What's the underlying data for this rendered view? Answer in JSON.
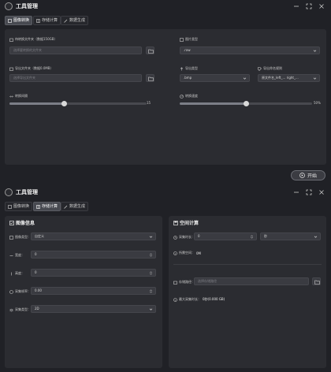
{
  "app": {
    "title": "工具管理"
  },
  "tabs": [
    {
      "label": "图像转换"
    },
    {
      "label": "存储计算"
    },
    {
      "label": "数据生成"
    }
  ],
  "convert": {
    "source_folder_label": "待转换文件夹（数据150GB）",
    "source_folder_placeholder": "选择要转换的文件夹",
    "output_folder_label": "导出文件夹（数据0.0MB）",
    "output_folder_placeholder": "选择导出文件夹",
    "image_type_label": "图片类型",
    "image_type_value": ".raw",
    "export_type_label": "导出类型",
    "export_type_value": ".bmp",
    "naming_rule_label": "导出命名规则",
    "naming_rule_value": "原文件名_left_... right_...",
    "interval_label": "转换间隔",
    "interval_value": "15",
    "interval_level": 0.4,
    "speed_label": "转换速度",
    "speed_value": "50%",
    "speed_level": 0.5,
    "start_label": "开始"
  },
  "calc": {
    "image_info_title": "图像信息",
    "image_type_label": "图像类型：",
    "image_type_value": "自定义",
    "width_label": "宽度：",
    "width_value": "0",
    "height_label": "高度：",
    "height_value": "0",
    "framerate_label": "采集帧率：",
    "framerate_value": "0.00",
    "bitdepth_label": "采集类型：",
    "bitdepth_value": "2D",
    "space_title": "空间计算",
    "duration_label": "采集时长：",
    "duration_value": "0",
    "duration_unit": "秒",
    "required_label": "所需空间：",
    "required_value": "0M",
    "path_label": "存储路径：",
    "path_placeholder": "选择存储路径",
    "max_label": "最大采集时长：",
    "max_value": "0秒(0.000 GB)"
  },
  "colors": {
    "accent": "#474950",
    "panel": "#2b2c31",
    "background": "#202126"
  }
}
